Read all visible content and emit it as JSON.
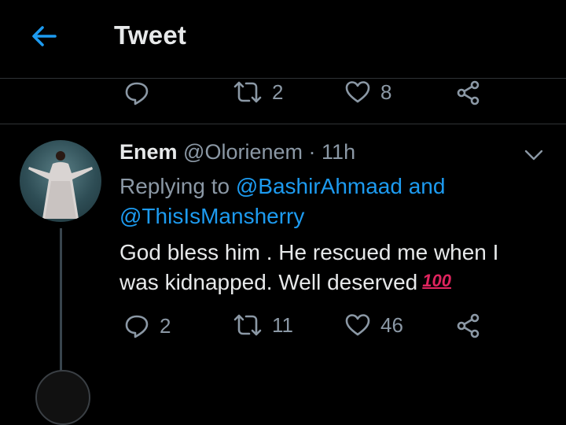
{
  "header": {
    "title": "Tweet"
  },
  "top_actions": {
    "retweets": "2",
    "likes": "8"
  },
  "reply": {
    "name": "Enem",
    "handle": "@Olorienem",
    "separator": "·",
    "time": "11h",
    "replying_prefix": "Replying to",
    "mention1": "@BashirAhmaad",
    "and": "and",
    "mention2": "@ThisIsMansherry",
    "text_line1": "God bless him . He rescued me when I",
    "text_line2": "was kidnapped. Well deserved",
    "emoji": "100",
    "actions": {
      "replies": "2",
      "retweets": "11",
      "likes": "46"
    }
  },
  "colors": {
    "background": "#000000",
    "text": "#e7e9ea",
    "muted": "#8b98a5",
    "accent": "#1d9bf0",
    "divider": "#2f3336"
  }
}
